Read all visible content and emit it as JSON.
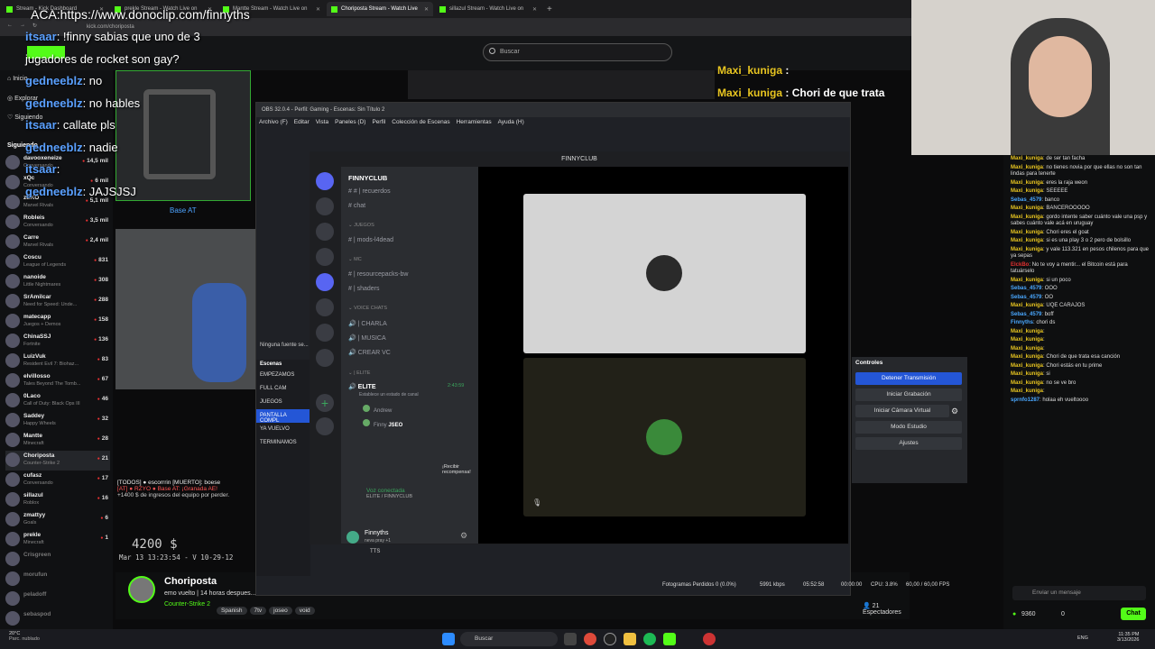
{
  "browser": {
    "tabs": [
      "Stream - Kick Dashboard",
      "prekle Stream - Watch Live on",
      "Mantte Stream - Watch Live on",
      "Choriposta Stream - Watch Live",
      "sillazul Stream - Watch Live on"
    ],
    "url": "kick.com/choriposta"
  },
  "search": {
    "placeholder": "Buscar"
  },
  "sidebar": {
    "home": "Inicio",
    "explore": "Explorar",
    "following": "Siguiendo",
    "following_header": "Siguiendo",
    "channels": [
      {
        "name": "davooxeneize",
        "game": "Conversando",
        "viewers": "14,5 mil"
      },
      {
        "name": "xQc",
        "game": "Conversando",
        "viewers": "6 mil"
      },
      {
        "name": "zEKO",
        "game": "Marvel Rivals",
        "viewers": "5,1 mil"
      },
      {
        "name": "Robleis",
        "game": "Conversando",
        "viewers": "3,5 mil"
      },
      {
        "name": "Carre",
        "game": "Marvel Rivals",
        "viewers": "2,4 mil"
      },
      {
        "name": "Coscu",
        "game": "League of Legends",
        "viewers": "831"
      },
      {
        "name": "nanoide",
        "game": "Little Nightmares",
        "viewers": "308"
      },
      {
        "name": "SrAmilcar",
        "game": "Need for Speed: Unde...",
        "viewers": "288"
      },
      {
        "name": "matecapp",
        "game": "Juegos + Demos",
        "viewers": "158"
      },
      {
        "name": "ChinaSSJ",
        "game": "Fortnite",
        "viewers": "136"
      },
      {
        "name": "LuizVuk",
        "game": "Resident Evil 7: Biohaz...",
        "viewers": "83"
      },
      {
        "name": "elvillosso",
        "game": "Tales Beyond The Tomb...",
        "viewers": "67"
      },
      {
        "name": "0Laco",
        "game": "Call of Duty: Black Ops III",
        "viewers": "46"
      },
      {
        "name": "Saddey",
        "game": "Happy Wheels",
        "viewers": "32"
      },
      {
        "name": "Mantte",
        "game": "Minecraft",
        "viewers": "28"
      },
      {
        "name": "Choriposta",
        "game": "Counter-Strike 2",
        "viewers": "21"
      },
      {
        "name": "cufasz",
        "game": "Conversando",
        "viewers": "17"
      },
      {
        "name": "sillazul",
        "game": "Roblox",
        "viewers": "16"
      },
      {
        "name": "zmattyy",
        "game": "Goals",
        "viewers": "6"
      },
      {
        "name": "prekle",
        "game": "Minecraft",
        "viewers": "1"
      },
      {
        "name": "Crisgreen",
        "game": "",
        "viewers": ""
      },
      {
        "name": "morufun",
        "game": "",
        "viewers": ""
      },
      {
        "name": "peladoff",
        "game": "",
        "viewers": ""
      },
      {
        "name": "sebaspod",
        "game": "",
        "viewers": ""
      }
    ]
  },
  "overlay": {
    "aca": "ACA:https://www.donoclip.com/finnyths",
    "messages": [
      {
        "user": "itsaar",
        "text": ": !finny sabias que uno de 3"
      },
      {
        "user": "",
        "text": "jugadores de rocket son gay?"
      },
      {
        "user": "gedneeblz",
        "text": ": no"
      },
      {
        "user": "gedneeblz",
        "text": ": no hables"
      },
      {
        "user": "itsaar",
        "text": ": callate pls"
      },
      {
        "user": "gedneeblz",
        "text": ": nadie"
      },
      {
        "user": "itsaar",
        "text": ":"
      },
      {
        "user": "gedneeblz",
        "text": ": JAJSJSJ"
      }
    ],
    "map_label": "Base AT",
    "top_chat": [
      {
        "user": "Maxi_kuniga",
        "text": ":"
      },
      {
        "user": "Maxi_kuniga",
        "text": ": Chori de que trata"
      }
    ],
    "killfeed": [
      "[TODOS] ● escorrrin [MUERTO]: boese",
      "[AT] ● RZYO ● Base AT: ¡Granada AE!",
      "+1400 $ de ingresos del equipo por perder."
    ],
    "money": "4200 $",
    "timestamp": "Mar 13 13:23:54 - V 10-29-12"
  },
  "stream": {
    "channel": "Choriposta",
    "title": "emo vuelto | 14 horas despues...",
    "game": "Counter-Strike 2",
    "tags": [
      "Spanish",
      "7tv",
      "joseo",
      "void"
    ]
  },
  "obs": {
    "title": "OBS 32.0.4 - Perfil: Gaming - Escenas: Sin Título 2",
    "menu": [
      "Archivo (F)",
      "Editar",
      "Vista",
      "Paneles (D)",
      "Perfil",
      "Colección de Escenas",
      "Herramientas",
      "Ayuda (H)"
    ],
    "no_source": "Ninguna fuente se...",
    "scenes_label": "Escenas",
    "scenes": [
      "EMPEZAMOS",
      "FULL CAM",
      "JUEGOS",
      "PANTALLA COMPL",
      "YA VUELVO",
      "TERMINAMOS"
    ],
    "controls_label": "Controles",
    "controls": [
      "Detener Transmisión",
      "Iniciar Grabación",
      "Iniciar Cámara Virtual",
      "Modo Estudio",
      "Ajustes"
    ],
    "status": {
      "dropped": "Fotogramas Perdidos 0 (0.0%)",
      "kbps": "5991 kbps",
      "live": "05:52:58",
      "rec": "00:00:00",
      "cpu": "CPU: 3.8%",
      "fps": "60,00 / 60,00 FPS"
    },
    "tts": "TTS"
  },
  "discord": {
    "window_title": "FINNYCLUB",
    "server": "FINNYCLUB",
    "channels": [
      {
        "label": "# | recuerdos",
        "type": "text"
      },
      {
        "label": "chat",
        "type": "text"
      },
      {
        "label": "JUEGOS",
        "type": "cat"
      },
      {
        "label": "| mods-l4dead",
        "type": "text"
      },
      {
        "label": "MC",
        "type": "cat"
      },
      {
        "label": "| resourcepacks-bw",
        "type": "text"
      },
      {
        "label": "| shaders",
        "type": "text"
      },
      {
        "label": "VOICE CHATS",
        "type": "cat"
      },
      {
        "label": "| CHARLA",
        "type": "voice"
      },
      {
        "label": "| MUSICA",
        "type": "voice"
      },
      {
        "label": "CREAR VC",
        "type": "voice"
      },
      {
        "label": "| ELITE",
        "type": "cat"
      },
      {
        "label": "ELITE",
        "type": "voice-active"
      }
    ],
    "elite_status": "Establece un estado de canal",
    "elite_time": "2:43:59",
    "members": [
      "Andrew",
      "Finny",
      "JSEO"
    ],
    "promo": "¡Recibir recompensa!",
    "voice_connected": "Voz conectada",
    "voice_channel": "ELITE / FINNYCLUB",
    "user": "Finnyths",
    "user_status": "neva pray +1"
  },
  "chat": {
    "messages": [
      {
        "user": "Maxi_kuniga",
        "color": "#e8c520",
        "text": "de ser tan facha"
      },
      {
        "user": "Maxi_kuniga",
        "color": "#e8c520",
        "text": "no tienes novia por que ellas no son tan lindas para tenerte"
      },
      {
        "user": "Maxi_kuniga",
        "color": "#e8c520",
        "text": "eres la raja weon"
      },
      {
        "user": "Maxi_kuniga",
        "color": "#e8c520",
        "text": "SEEEEE"
      },
      {
        "user": "Sebas_4579",
        "color": "#4aa8ff",
        "text": "banco"
      },
      {
        "user": "Maxi_kuniga",
        "color": "#e8c520",
        "text": "BANCEROOOOO"
      },
      {
        "user": "Maxi_kuniga",
        "color": "#e8c520",
        "text": "gordo intente saber cuánto vale una psp y sabes cuánto vale acá en uruguay"
      },
      {
        "user": "Maxi_kuniga",
        "color": "#e8c520",
        "text": "Chori eres el goat"
      },
      {
        "user": "Maxi_kuniga",
        "color": "#e8c520",
        "text": "si es una play 3 o 2 pero de bolsillo"
      },
      {
        "user": "Maxi_kuniga",
        "color": "#e8c520",
        "text": "y vale 113.321 en pesos chilenos para que ya sepas"
      },
      {
        "user": "ElckBo",
        "color": "#e03030",
        "text": "No te voy a mentir... el Bitcoin está para tatuárselo"
      },
      {
        "user": "Maxi_kuniga",
        "color": "#e8c520",
        "text": "si un poco"
      },
      {
        "user": "Sebas_4579",
        "color": "#4aa8ff",
        "text": "OOO"
      },
      {
        "user": "Sebas_4579",
        "color": "#4aa8ff",
        "text": "OO"
      },
      {
        "user": "Maxi_kuniga",
        "color": "#e8c520",
        "text": "UQE CARAJOS"
      },
      {
        "user": "Sebas_4579",
        "color": "#4aa8ff",
        "text": "boff"
      },
      {
        "user": "Finnyths",
        "color": "#4aa8ff",
        "text": "chori ds"
      },
      {
        "user": "Maxi_kuniga",
        "color": "#e8c520",
        "text": ""
      },
      {
        "user": "Maxi_kuniga",
        "color": "#e8c520",
        "text": ""
      },
      {
        "user": "Maxi_kuniga",
        "color": "#e8c520",
        "text": ""
      },
      {
        "user": "Maxi_kuniga",
        "color": "#e8c520",
        "text": "Chori de que trata esa canción"
      },
      {
        "user": "Maxi_kuniga",
        "color": "#e8c520",
        "text": "Chori estás en tu prime"
      },
      {
        "user": "Maxi_kuniga",
        "color": "#e8c520",
        "text": "si"
      },
      {
        "user": "Maxi_kuniga",
        "color": "#e8c520",
        "text": "no se ve bro"
      },
      {
        "user": "Maxi_kuniga",
        "color": "#e8c520",
        "text": ""
      },
      {
        "user": "sprnfo1287",
        "color": "#4aa8ff",
        "text": "holaa eh vueltoooo"
      }
    ],
    "input_placeholder": "Enviar un mensaje",
    "points": "9360",
    "count": "0",
    "send_label": "Chat",
    "viewers": "21 Espectadores"
  },
  "taskbar": {
    "weather_temp": "20°C",
    "weather_desc": "Parc. nublado",
    "search": "Buscar",
    "lang": "ENG",
    "time": "11:35 PM",
    "date": "3/13/2026"
  },
  "colors": {
    "kick_green": "#53fc18",
    "obs_blue": "#2456d6",
    "discord_bg": "#313338"
  }
}
